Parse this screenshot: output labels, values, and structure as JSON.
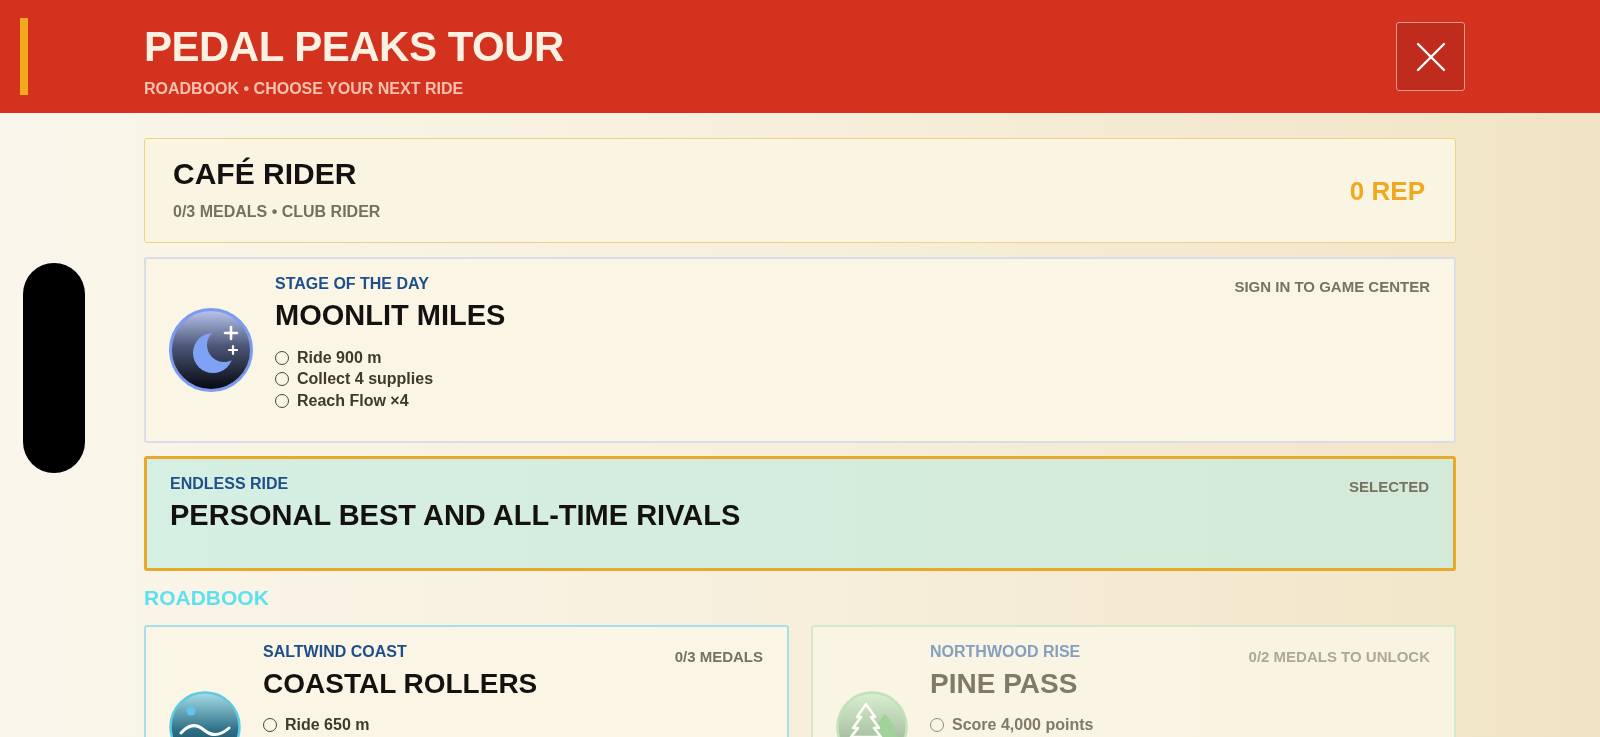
{
  "header": {
    "title": "PEDAL PEAKS TOUR",
    "subtitle": "ROADBOOK • CHOOSE YOUR NEXT RIDE"
  },
  "profile": {
    "name": "CAFÉ RIDER",
    "stats": "0/3 MEDALS • CLUB RIDER",
    "rep": "0 REP"
  },
  "modes": [
    {
      "kind": "daily",
      "label": "STAGE OF THE DAY",
      "title": "MOONLIT MILES",
      "status": "SIGN IN TO GAME CENTER",
      "selected": false,
      "objectives": [
        {
          "text": "Ride 900 m",
          "checked": false
        },
        {
          "text": "Collect 4 supplies",
          "checked": false
        },
        {
          "text": "Reach Flow ×4",
          "checked": false
        }
      ]
    },
    {
      "kind": "endless",
      "label": "ENDLESS RIDE",
      "title": "PERSONAL BEST AND ALL-TIME RIVALS",
      "status": "SELECTED",
      "selected": true
    }
  ],
  "roadbook": {
    "heading": "ROADBOOK",
    "stages": [
      {
        "kind": "coast",
        "region": "SALTWIND COAST",
        "title": "COASTAL ROLLERS",
        "progress": "0/3 MEDALS",
        "locked": false,
        "selected": false,
        "objectives": [
          {
            "text": "Ride 650 m",
            "checked": false
          }
        ]
      },
      {
        "kind": "forest",
        "region": "NORTHWOOD RISE",
        "title": "PINE PASS",
        "progress": "0/2 MEDALS TO UNLOCK",
        "locked": true,
        "selected": false,
        "objectives": [
          {
            "text": "Score 4,000 points",
            "checked": false
          }
        ]
      }
    ]
  }
}
